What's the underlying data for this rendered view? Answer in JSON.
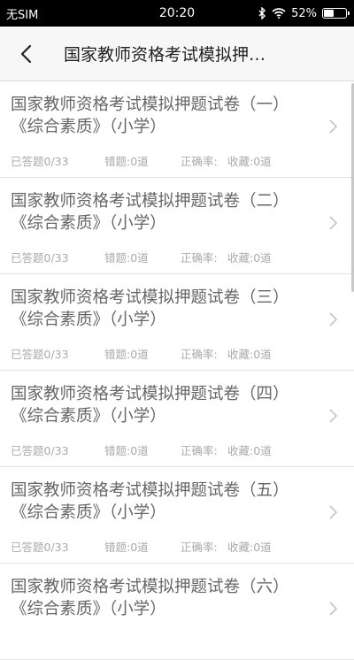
{
  "statusbar": {
    "carrier": "无SIM",
    "time": "20:20",
    "battery_text": "52%",
    "battery_level": 0.52
  },
  "appbar": {
    "title": "国家教师资格考试模拟押…"
  },
  "items": [
    {
      "title_line1": "国家教师资格考试模拟押题试卷（一）",
      "title_line2": "《综合素质》（小学）",
      "answered": "已答题0/33",
      "wrong": "错题:0道",
      "accuracy": "正确率:",
      "favorites": "收藏:0道"
    },
    {
      "title_line1": "国家教师资格考试模拟押题试卷（二）",
      "title_line2": "《综合素质》（小学）",
      "answered": "已答题0/33",
      "wrong": "错题:0道",
      "accuracy": "正确率:",
      "favorites": "收藏:0道"
    },
    {
      "title_line1": "国家教师资格考试模拟押题试卷（三）",
      "title_line2": "《综合素质》（小学）",
      "answered": "已答题0/33",
      "wrong": "错题:0道",
      "accuracy": "正确率:",
      "favorites": "收藏:0道"
    },
    {
      "title_line1": "国家教师资格考试模拟押题试卷（四）",
      "title_line2": "《综合素质》（小学）",
      "answered": "已答题0/33",
      "wrong": "错题:0道",
      "accuracy": "正确率:",
      "favorites": "收藏:0道"
    },
    {
      "title_line1": "国家教师资格考试模拟押题试卷（五）",
      "title_line2": "《综合素质》（小学）",
      "answered": "已答题0/33",
      "wrong": "错题:0道",
      "accuracy": "正确率:",
      "favorites": "收藏:0道"
    },
    {
      "title_line1": "国家教师资格考试模拟押题试卷（六）",
      "title_line2": "《综合素质》（小学）",
      "answered": "",
      "wrong": "",
      "accuracy": "",
      "favorites": ""
    }
  ],
  "icons": {
    "back": "chevron-left-icon",
    "row_arrow": "chevron-right-icon",
    "bluetooth": "bluetooth-icon",
    "wifi": "wifi-icon",
    "battery": "battery-icon"
  },
  "colors": {
    "statusbar_bg": "#000000",
    "appbar_bg": "#f7f7f7",
    "item_title": "#666666",
    "item_stats": "#aaaaaa"
  }
}
